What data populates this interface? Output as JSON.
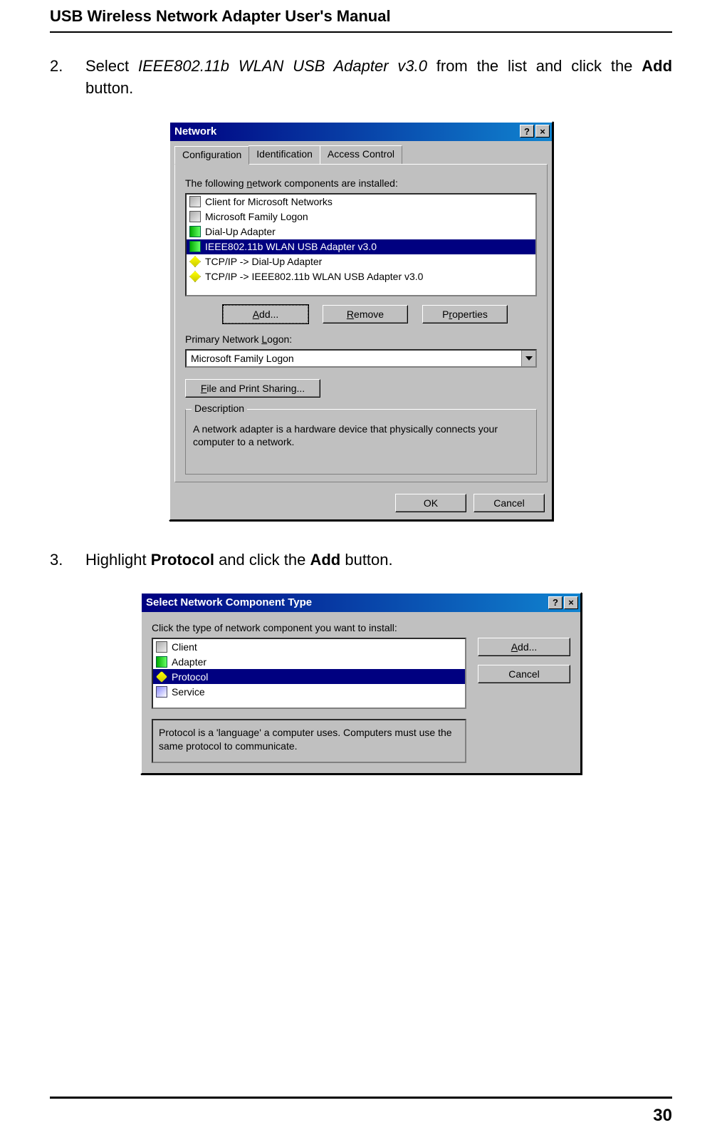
{
  "header": "USB Wireless Network Adapter User's Manual",
  "page_number": "30",
  "step2": {
    "num": "2.",
    "line1_a": "Select ",
    "line1_b": "IEEE802.11b WLAN USB Adapter v3.0",
    "line1_c": " from the list and click the ",
    "line1_d": "Add",
    "line2": "button."
  },
  "step3": {
    "num": "3.",
    "text_a": "Highlight ",
    "text_b": "Protocol",
    "text_c": " and click the ",
    "text_d": "Add",
    "text_e": " button."
  },
  "dlg1": {
    "title": "Network",
    "help": "?",
    "close": "×",
    "tabs": [
      "Configuration",
      "Identification",
      "Access Control"
    ],
    "list_label_pre": "The following ",
    "list_label_u": "n",
    "list_label_post": "etwork components are installed:",
    "items": [
      {
        "icon": "client",
        "text": "Client for Microsoft Networks"
      },
      {
        "icon": "client",
        "text": "Microsoft Family Logon"
      },
      {
        "icon": "adapter",
        "text": "Dial-Up Adapter"
      },
      {
        "icon": "adapter",
        "text": "IEEE802.11b WLAN USB Adapter v3.0",
        "selected": true
      },
      {
        "icon": "proto",
        "text": "TCP/IP -> Dial-Up Adapter"
      },
      {
        "icon": "proto",
        "text": "TCP/IP -> IEEE802.11b WLAN USB Adapter v3.0"
      }
    ],
    "btn_add_u": "A",
    "btn_add": "dd...",
    "btn_remove_u": "R",
    "btn_remove_pre": "",
    "btn_remove": "emove",
    "btn_props_pre": "P",
    "btn_props_u": "r",
    "btn_props": "operties",
    "primary_label_pre": "Primary Network ",
    "primary_label_u": "L",
    "primary_label_post": "ogon:",
    "primary_value": "Microsoft Family Logon",
    "share_btn_u": "F",
    "share_btn": "ile and Print Sharing...",
    "group_label": "Description",
    "description": "A network adapter is a hardware device that physically connects your computer to a network.",
    "ok": "OK",
    "cancel": "Cancel"
  },
  "dlg2": {
    "title": "Select Network Component Type",
    "help": "?",
    "close": "×",
    "label": "Click the type of network component you want to install:",
    "items": [
      {
        "icon": "client",
        "text": "Client"
      },
      {
        "icon": "adapter",
        "text": "Adapter"
      },
      {
        "icon": "proto",
        "text": "Protocol",
        "selected": true
      },
      {
        "icon": "service",
        "text": "Service"
      }
    ],
    "add_u": "A",
    "add": "dd...",
    "cancel": "Cancel",
    "description": "Protocol is a 'language' a computer uses. Computers must use the same protocol to communicate."
  }
}
